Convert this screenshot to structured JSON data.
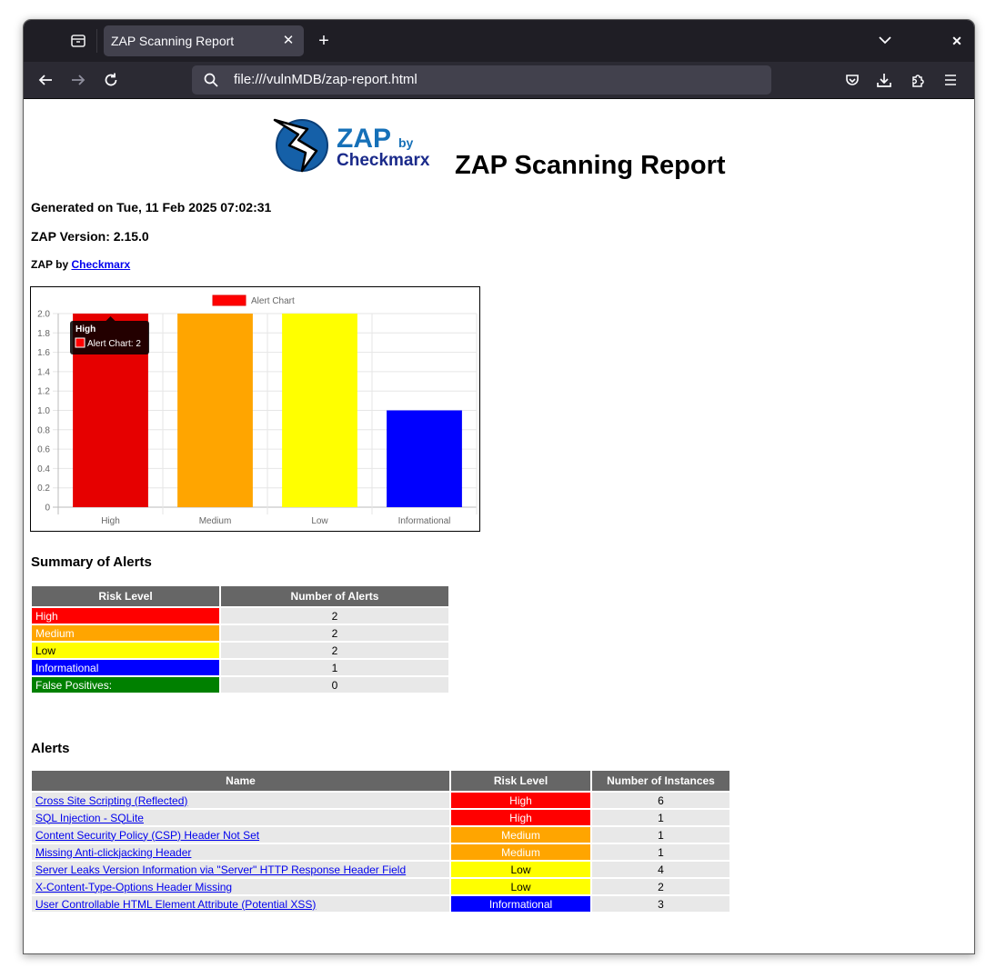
{
  "browser": {
    "tab_title": "ZAP Scanning Report",
    "url": "file:///vulnMDB/zap-report.html"
  },
  "report": {
    "logo_text_main": "ZAP",
    "logo_text_by": "by",
    "logo_text_brand": "Checkmarx",
    "title": "ZAP Scanning Report",
    "generated": "Generated on Tue, 11 Feb 2025 07:02:31",
    "version": "ZAP Version: 2.15.0",
    "by_prefix": "ZAP by",
    "by_link": "Checkmarx"
  },
  "chart_data": {
    "type": "bar",
    "legend": "Alert Chart",
    "legend_position": "top",
    "categories": [
      "High",
      "Medium",
      "Low",
      "Informational"
    ],
    "values": [
      2,
      2,
      2,
      1
    ],
    "colors": [
      "#e60000",
      "#ffa500",
      "#ffff00",
      "#0000ff"
    ],
    "ylim": [
      0,
      2.0
    ],
    "yticks": [
      "0",
      "0.2",
      "0.4",
      "0.6",
      "0.8",
      "1.0",
      "1.2",
      "1.4",
      "1.6",
      "1.8",
      "2.0"
    ],
    "grid": true,
    "tooltip": {
      "title": "High",
      "label": "Alert Chart: 2"
    }
  },
  "summary": {
    "heading": "Summary of Alerts",
    "headers": [
      "Risk Level",
      "Number of Alerts"
    ],
    "rows": [
      {
        "level": "High",
        "count": "2"
      },
      {
        "level": "Medium",
        "count": "2"
      },
      {
        "level": "Low",
        "count": "2"
      },
      {
        "level": "Informational",
        "count": "1"
      },
      {
        "level": "False Positives:",
        "count": "0"
      }
    ]
  },
  "alerts": {
    "heading": "Alerts",
    "headers": [
      "Name",
      "Risk Level",
      "Number of Instances"
    ],
    "rows": [
      {
        "name": "Cross Site Scripting (Reflected)",
        "risk": "High",
        "count": "6"
      },
      {
        "name": "SQL Injection - SQLite",
        "risk": "High",
        "count": "1"
      },
      {
        "name": "Content Security Policy (CSP) Header Not Set",
        "risk": "Medium",
        "count": "1"
      },
      {
        "name": "Missing Anti-clickjacking Header",
        "risk": "Medium",
        "count": "1"
      },
      {
        "name": "Server Leaks Version Information via \"Server\" HTTP Response Header Field",
        "risk": "Low",
        "count": "4"
      },
      {
        "name": "X-Content-Type-Options Header Missing",
        "risk": "Low",
        "count": "2"
      },
      {
        "name": "User Controllable HTML Element Attribute (Potential XSS)",
        "risk": "Informational",
        "count": "3"
      }
    ]
  },
  "colors": {
    "high": "#ff0000",
    "medium": "#ffa500",
    "low": "#ffff00",
    "informational": "#0000ff",
    "false_positive": "#008000",
    "table_header": "#666666"
  }
}
